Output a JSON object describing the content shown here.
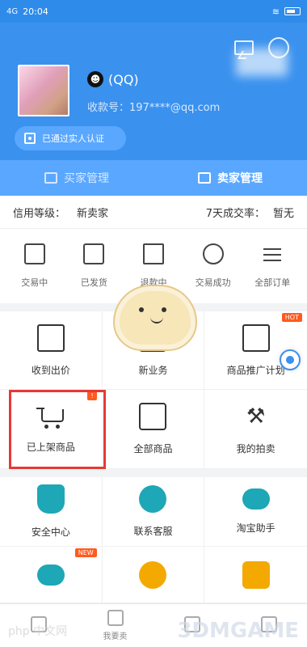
{
  "status": {
    "network": "4G",
    "time": "20:04"
  },
  "header": {
    "nickname": "(QQ)",
    "account_prefix": "收款号：",
    "account_value": "197****@qq.com",
    "verify_label": "已通过实人认证"
  },
  "tabs": {
    "buyer": "买家管理",
    "seller": "卖家管理"
  },
  "info": {
    "credit_label": "信用等级：",
    "credit_value": "新卖家",
    "payout_label": "7天成交率：",
    "payout_value": "暂无"
  },
  "orders": [
    {
      "label": "交易中",
      "icon": "money-icon"
    },
    {
      "label": "已发货",
      "icon": "truck-icon"
    },
    {
      "label": "退款中",
      "icon": "book-icon"
    },
    {
      "label": "交易成功",
      "icon": "smile-icon"
    },
    {
      "label": "全部订单",
      "icon": "list-icon"
    }
  ],
  "grid1": [
    {
      "label": "收到出价",
      "icon": "cup-icon"
    },
    {
      "label": "新业务",
      "icon": "lock-icon"
    },
    {
      "label": "商品推广计划",
      "icon": "calendar-star-icon",
      "badge": "HOT"
    }
  ],
  "grid2": [
    {
      "label": "已上架商品",
      "icon": "cart-icon",
      "badge": "!"
    },
    {
      "label": "全部商品",
      "icon": "bag-icon"
    },
    {
      "label": "我的拍卖",
      "icon": "gavel-icon"
    }
  ],
  "grid3": [
    {
      "label": "安全中心",
      "icon": "shield-icon"
    },
    {
      "label": "联系客服",
      "icon": "support-icon"
    },
    {
      "label": "淘宝助手",
      "icon": "gamepad-icon"
    }
  ],
  "grid4": [
    {
      "label": "",
      "icon": "gamepad-icon",
      "badge": "NEW"
    },
    {
      "label": "",
      "icon": "moneybag-icon"
    },
    {
      "label": "",
      "icon": "coin-icon"
    }
  ],
  "tabbar": [
    {
      "label": ""
    },
    {
      "label": "我要卖"
    },
    {
      "label": ""
    },
    {
      "label": ""
    }
  ],
  "watermark": {
    "left": "php 中文网",
    "right": "3DMGAME"
  }
}
